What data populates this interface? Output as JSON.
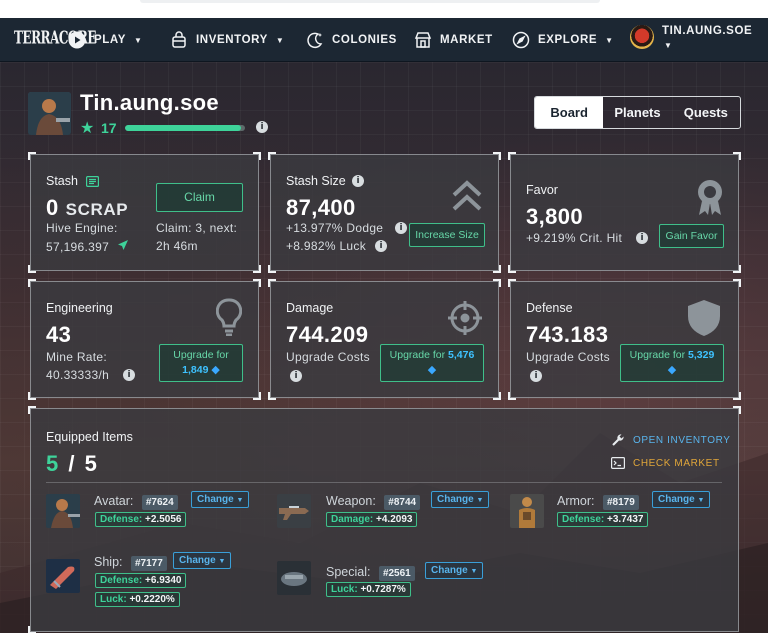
{
  "nav": {
    "logo": "TERRACORE",
    "items": [
      {
        "label": "PLAY",
        "icon": "play-icon",
        "caret": true
      },
      {
        "label": "INVENTORY",
        "icon": "backpack-icon",
        "caret": true
      },
      {
        "label": "COLONIES",
        "icon": "moon-icon",
        "caret": false
      },
      {
        "label": "MARKET",
        "icon": "store-icon",
        "caret": false
      },
      {
        "label": "EXPLORE",
        "icon": "compass-icon",
        "caret": true
      }
    ],
    "user": "TIN.AUNG.SOE"
  },
  "profile": {
    "name": "Tin.aung.soe",
    "level": "17",
    "xp_fraction": 0.97
  },
  "tabs": [
    "Board",
    "Planets",
    "Quests"
  ],
  "active_tab": "Board",
  "stash": {
    "label": "Stash",
    "amount": "0",
    "unit": "SCRAP",
    "hive_label": "Hive Engine:",
    "hive_value": "57,196.397",
    "claim_button": "Claim",
    "claim_text": "Claim: 3, next:",
    "claim_time": "2h 46m"
  },
  "stash_size": {
    "label": "Stash Size",
    "value": "87,400",
    "dodge": "+13.977% Dodge",
    "luck": "+8.982% Luck",
    "button": "Increase Size"
  },
  "favor": {
    "label": "Favor",
    "value": "3,800",
    "crit": "+9.219% Crit. Hit",
    "button": "Gain Favor"
  },
  "engineering": {
    "label": "Engineering",
    "value": "43",
    "rate_label": "Mine Rate:",
    "rate_value": "40.33333/h",
    "button_top": "Upgrade for",
    "button_value": "1,849"
  },
  "damage": {
    "label": "Damage",
    "value": "744.209",
    "costs_label": "Upgrade Costs",
    "button_top": "Upgrade for",
    "button_value": "5,476"
  },
  "defense": {
    "label": "Defense",
    "value": "743.183",
    "costs_label": "Upgrade Costs",
    "button_top": "Upgrade for",
    "button_value": "5,329"
  },
  "equipped": {
    "title": "Equipped Items",
    "count": "5",
    "total": "5",
    "open_inventory": "OPEN INVENTORY",
    "check_market": "CHECK MARKET",
    "change_label": "Change",
    "items": [
      {
        "slot": "Avatar:",
        "id": "#7624",
        "stats": [
          {
            "k": "Defense:",
            "v": "+2.5056"
          }
        ]
      },
      {
        "slot": "Weapon:",
        "id": "#8744",
        "stats": [
          {
            "k": "Damage:",
            "v": "+4.2093"
          }
        ]
      },
      {
        "slot": "Armor:",
        "id": "#8179",
        "stats": [
          {
            "k": "Defense:",
            "v": "+3.7437"
          }
        ]
      },
      {
        "slot": "Ship:",
        "id": "#7177",
        "stats": [
          {
            "k": "Defense:",
            "v": "+6.9340"
          },
          {
            "k": "Luck:",
            "v": "+0.2220%"
          }
        ]
      },
      {
        "slot": "Special:",
        "id": "#2561",
        "stats": [
          {
            "k": "Luck:",
            "v": "+0.7287%"
          }
        ]
      }
    ]
  },
  "colors": {
    "accent_green": "#3ed39a",
    "accent_blue": "#59b4ec",
    "accent_orange": "#e0a63a",
    "nav_bg": "#1c2733"
  }
}
